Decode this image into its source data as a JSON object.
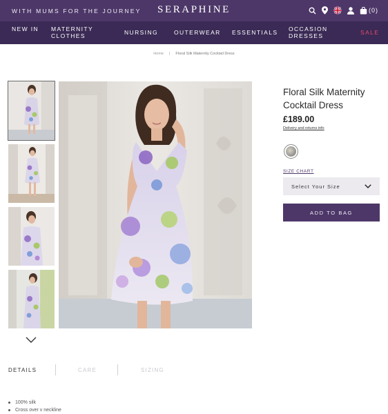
{
  "header": {
    "tagline": "WITH MUMS FOR THE JOURNEY",
    "logo": "SERAPHINE",
    "icons": [
      "search-icon",
      "location-pin-icon",
      "uk-flag-icon",
      "account-icon",
      "shopping-bag-icon"
    ],
    "bag_count": "(0)"
  },
  "nav": {
    "items": [
      {
        "label": "NEW IN"
      },
      {
        "label": "MATERNITY CLOTHES"
      },
      {
        "label": "NURSING"
      },
      {
        "label": "OUTERWEAR"
      },
      {
        "label": "ESSENTIALS"
      },
      {
        "label": "OCCASION DRESSES"
      },
      {
        "label": "SALE"
      }
    ]
  },
  "breadcrumb": {
    "home": "Home",
    "separator": "|",
    "current": "Floral Silk Maternity Cocktail Dress"
  },
  "gallery": {
    "thumbnail_count": 4,
    "active_thumbnail": 1
  },
  "product": {
    "title": "Floral Silk Maternity Cocktail Dress",
    "price": "£189.00",
    "delivery_link": "Delivery and returns info",
    "size_chart_link": "SIZE CHART",
    "size_placeholder": "Select Your Size",
    "add_to_bag": "ADD TO BAG"
  },
  "tabs": [
    {
      "label": "DETAILS",
      "active": true
    },
    {
      "label": "CARE",
      "active": false
    },
    {
      "label": "SIZING",
      "active": false
    }
  ],
  "details": [
    "100% silk",
    "Cross over v neckline"
  ],
  "colors": {
    "brand_purple": "#4d3768",
    "nav_purple": "#3a2a55",
    "sale_red": "#e24b6b"
  }
}
